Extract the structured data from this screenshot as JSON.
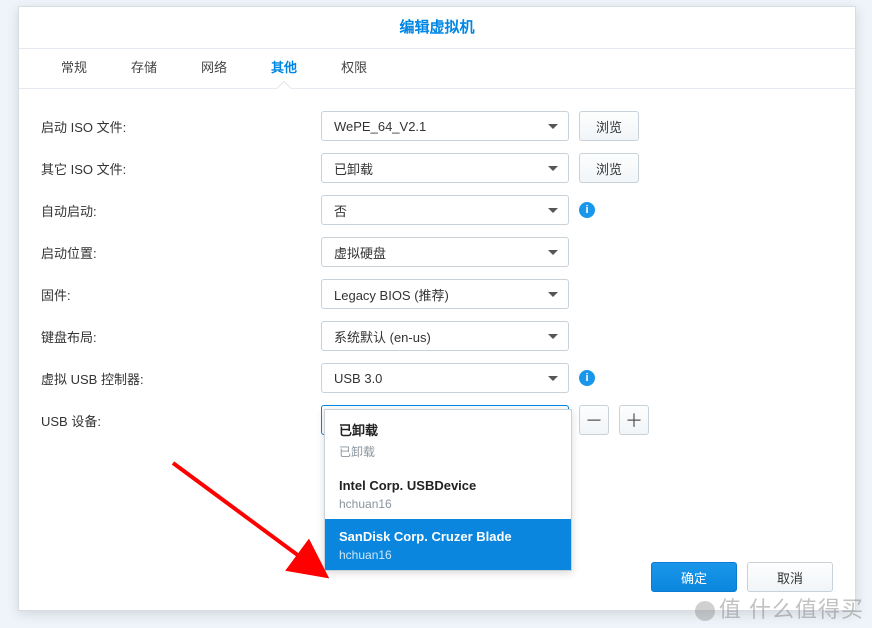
{
  "dialog": {
    "title": "编辑虚拟机"
  },
  "tabs": {
    "items": [
      "常规",
      "存储",
      "网络",
      "其他",
      "权限"
    ],
    "active": 3
  },
  "form": {
    "boot_iso": {
      "label": "启动 ISO 文件:",
      "value": "WePE_64_V2.1",
      "browse": "浏览"
    },
    "other_iso": {
      "label": "其它 ISO 文件:",
      "value": "已卸载",
      "browse": "浏览"
    },
    "autostart": {
      "label": "自动启动:",
      "value": "否"
    },
    "boot_from": {
      "label": "启动位置:",
      "value": "虚拟硬盘"
    },
    "firmware": {
      "label": "固件:",
      "value": "Legacy BIOS (推荐)"
    },
    "keyboard": {
      "label": "键盘布局:",
      "value": "系统默认 (en-us)"
    },
    "usb_controller": {
      "label": "虚拟 USB 控制器:",
      "value": "USB 3.0"
    },
    "usb_device": {
      "label": "USB 设备:",
      "value": "已卸载"
    }
  },
  "dropdown": {
    "options": [
      {
        "title": "已卸载",
        "sub": "已卸载",
        "selected": false
      },
      {
        "title": "Intel Corp. USBDevice",
        "sub": "hchuan16",
        "selected": false
      },
      {
        "title": "SanDisk Corp. Cruzer Blade",
        "sub": "hchuan16",
        "selected": true
      }
    ]
  },
  "footer": {
    "ok": "确定",
    "cancel": "取消"
  },
  "icons": {
    "minus": "－",
    "plus": "＋",
    "info": "i"
  },
  "watermark": "值 什么值得买"
}
